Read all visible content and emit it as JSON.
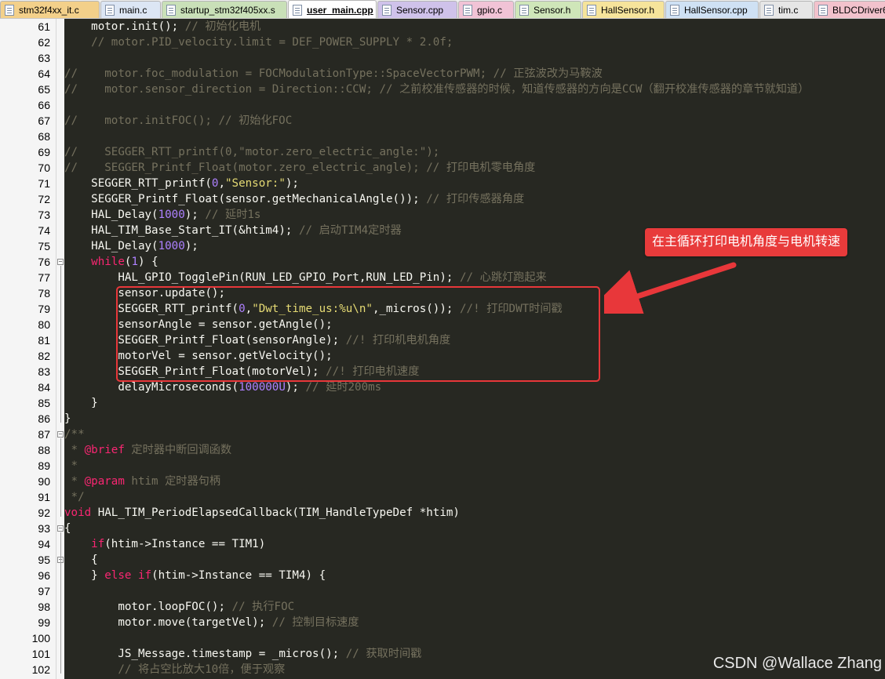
{
  "tabs": [
    {
      "label": "stm32f4xx_it.c",
      "color": "#f3d08a",
      "active": false
    },
    {
      "label": "main.c",
      "color": "#dce6f4",
      "active": false
    },
    {
      "label": "startup_stm32f405xx.s",
      "color": "#c9e0b8",
      "active": false
    },
    {
      "label": "user_main.cpp",
      "color": "#ffffff",
      "active": true
    },
    {
      "label": "Sensor.cpp",
      "color": "#cfc2ea",
      "active": false
    },
    {
      "label": "gpio.c",
      "color": "#f1c3d6",
      "active": false
    },
    {
      "label": "Sensor.h",
      "color": "#cfe6b9",
      "active": false
    },
    {
      "label": "HallSensor.h",
      "color": "#f6e49b",
      "active": false
    },
    {
      "label": "HallSensor.cpp",
      "color": "#cfe1f4",
      "active": false
    },
    {
      "label": "tim.c",
      "color": "#e6e6e6",
      "active": false
    },
    {
      "label": "BLDCDriver6",
      "color": "#f2c2cc",
      "active": false
    }
  ],
  "code": [
    {
      "n": "61",
      "t": "    motor.init(); // 初始化电机"
    },
    {
      "n": "62",
      "t": "    // motor.PID_velocity.limit = DEF_POWER_SUPPLY * 2.0f;"
    },
    {
      "n": "63",
      "t": "    "
    },
    {
      "n": "64",
      "t": "//    motor.foc_modulation = FOCModulationType::SpaceVectorPWM; // 正弦波改为马鞍波"
    },
    {
      "n": "65",
      "t": "//    motor.sensor_direction = Direction::CCW; // 之前校准传感器的时候，知道传感器的方向是CCW（翻开校准传感器的章节就知道）"
    },
    {
      "n": "66",
      "t": ""
    },
    {
      "n": "67",
      "t": "//    motor.initFOC(); // 初始化FOC"
    },
    {
      "n": "68",
      "t": ""
    },
    {
      "n": "69",
      "t": "//    SEGGER_RTT_printf(0,\"motor.zero_electric_angle:\");"
    },
    {
      "n": "70",
      "t": "//    SEGGER_Printf_Float(motor.zero_electric_angle); // 打印电机零电角度"
    },
    {
      "n": "71",
      "t": "    SEGGER_RTT_printf(0,\"Sensor:\");"
    },
    {
      "n": "72",
      "t": "    SEGGER_Printf_Float(sensor.getMechanicalAngle()); // 打印传感器角度"
    },
    {
      "n": "73",
      "t": "    HAL_Delay(1000); // 延时1s"
    },
    {
      "n": "74",
      "t": "    HAL_TIM_Base_Start_IT(&htim4); // 启动TIM4定时器"
    },
    {
      "n": "75",
      "t": "    HAL_Delay(1000);"
    },
    {
      "n": "76",
      "t": "    while(1) {",
      "fold": "-"
    },
    {
      "n": "77",
      "t": "        HAL_GPIO_TogglePin(RUN_LED_GPIO_Port,RUN_LED_Pin); // 心跳灯跑起来"
    },
    {
      "n": "78",
      "t": "        sensor.update();"
    },
    {
      "n": "79",
      "t": "        SEGGER_RTT_printf(0,\"Dwt_time_us:%u\\n\",_micros()); //! 打印DWT时间戳"
    },
    {
      "n": "80",
      "t": "        sensorAngle = sensor.getAngle();"
    },
    {
      "n": "81",
      "t": "        SEGGER_Printf_Float(sensorAngle); //! 打印机电机角度"
    },
    {
      "n": "82",
      "t": "        motorVel = sensor.getVelocity();"
    },
    {
      "n": "83",
      "t": "        SEGGER_Printf_Float(motorVel); //! 打印电机速度"
    },
    {
      "n": "84",
      "t": "        delayMicroseconds(100000U); // 延时200ms"
    },
    {
      "n": "85",
      "t": "    }"
    },
    {
      "n": "86",
      "t": "}"
    },
    {
      "n": "87",
      "t": "/**",
      "fold": "-"
    },
    {
      "n": "88",
      "t": " * @brief 定时器中断回调函数"
    },
    {
      "n": "89",
      "t": " * "
    },
    {
      "n": "90",
      "t": " * @param htim 定时器句柄"
    },
    {
      "n": "91",
      "t": " */"
    },
    {
      "n": "92",
      "t": "void HAL_TIM_PeriodElapsedCallback(TIM_HandleTypeDef *htim)"
    },
    {
      "n": "93",
      "t": "{",
      "fold": "-"
    },
    {
      "n": "94",
      "t": "    if(htim->Instance == TIM1)"
    },
    {
      "n": "95",
      "t": "    {",
      "fold": "-"
    },
    {
      "n": "96",
      "t": "    } else if(htim->Instance == TIM4) {"
    },
    {
      "n": "97",
      "t": "        "
    },
    {
      "n": "98",
      "t": "        motor.loopFOC(); // 执行FOC"
    },
    {
      "n": "99",
      "t": "        motor.move(targetVel); // 控制目标速度"
    },
    {
      "n": "100",
      "t": "        "
    },
    {
      "n": "101",
      "t": "        JS_Message.timestamp = _micros(); // 获取时间戳"
    },
    {
      "n": "102",
      "t": "        // 将占空比放大10倍，便于观察"
    }
  ],
  "annotation": {
    "callout": "在主循环打印电机角度与电机转速",
    "box_color": "#e8373a"
  },
  "watermark": "CSDN @Wallace Zhang",
  "theme": {
    "background": "#272822",
    "comment": "#75715e",
    "keyword": "#f92672",
    "number": "#ae81ff",
    "string": "#e6db74",
    "text": "#f8f8f2"
  }
}
